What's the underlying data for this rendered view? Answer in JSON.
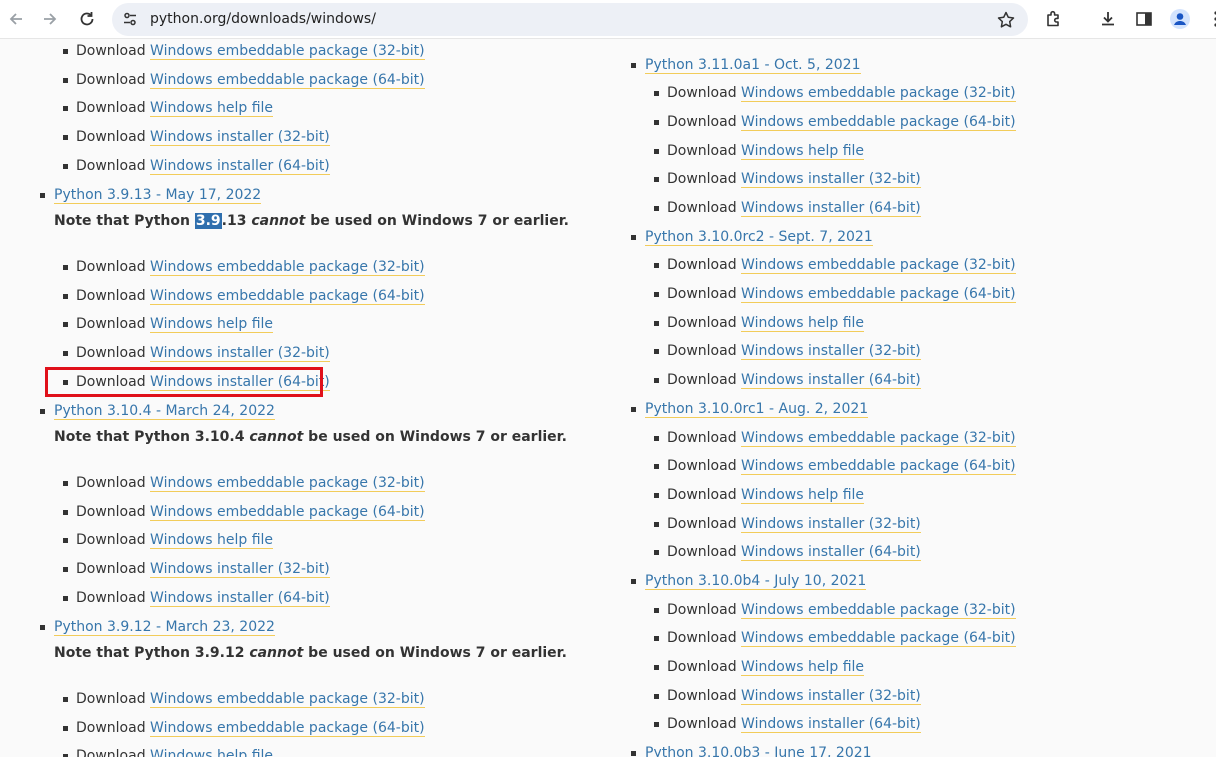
{
  "browser": {
    "url": "python.org/downloads/windows/"
  },
  "strings": {
    "download": "Download",
    "emb32": "Windows embeddable package (32-bit)",
    "emb64": "Windows embeddable package (64-bit)",
    "help": "Windows help file",
    "inst32": "Windows installer (32-bit)",
    "inst64": "Windows installer (64-bit)"
  },
  "left_column": {
    "releases": [
      {
        "title": "Python 3.9.13 - May 17, 2022",
        "note_prefix": "Note that Python ",
        "note_version_highlight": "3.9",
        "note_version_rest": ".13",
        "note_cannot": "cannot",
        "note_suffix": " be used on Windows 7 or earlier."
      },
      {
        "title": "Python 3.10.4 - March 24, 2022",
        "note_prefix": "Note that Python 3.10.4 ",
        "note_cannot": "cannot",
        "note_suffix": " be used on Windows 7 or earlier."
      },
      {
        "title": "Python 3.9.12 - March 23, 2022",
        "note_prefix": "Note that Python 3.9.12 ",
        "note_cannot": "cannot",
        "note_suffix": " be used on Windows 7 or earlier."
      }
    ]
  },
  "right_column": {
    "releases": [
      {
        "title": "Python 3.11.0a1 - Oct. 5, 2021"
      },
      {
        "title": "Python 3.10.0rc2 - Sept. 7, 2021"
      },
      {
        "title": "Python 3.10.0rc1 - Aug. 2, 2021"
      },
      {
        "title": "Python 3.10.0b4 - July 10, 2021"
      },
      {
        "title": "Python 3.10.0b3 - June 17, 2021"
      }
    ]
  },
  "colors": {
    "link": "#3776ab",
    "link_underline": "#f2cc5a",
    "highlight": "#2f6fae",
    "annotation_box": "#e0101a"
  },
  "icons": [
    "back-arrow-icon",
    "forward-arrow-icon",
    "reload-icon",
    "site-info-icon",
    "bookmark-star-icon",
    "extensions-icon",
    "download-icon",
    "side-panel-icon",
    "profile-icon",
    "more-menu-icon"
  ]
}
